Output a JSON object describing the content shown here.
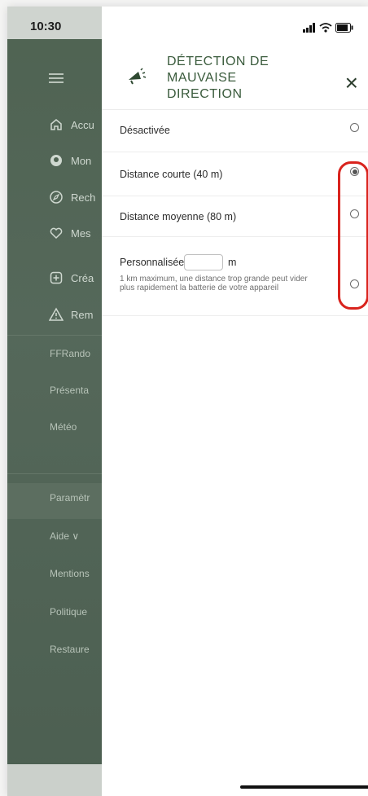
{
  "status_bar": {
    "time": "10:30"
  },
  "sidebar": {
    "menu_icon": "hamburger-icon",
    "items": [
      {
        "label": "Accu",
        "icon": "home-icon"
      },
      {
        "label": "Mon",
        "icon": "profile-icon"
      },
      {
        "label": "Rech",
        "icon": "compass-icon"
      },
      {
        "label": "Mes",
        "icon": "heart-icon"
      },
      {
        "label": "Créa",
        "icon": "plus-square-icon"
      },
      {
        "label": "Rem",
        "icon": "warning-icon"
      }
    ],
    "links": [
      {
        "label": "FFRando"
      },
      {
        "label": "Présenta"
      },
      {
        "label": "Météo"
      },
      {
        "label": "Paramètr"
      },
      {
        "label": "Aide ∨"
      },
      {
        "label": "Mentions"
      },
      {
        "label": "Politique"
      },
      {
        "label": "Restaure"
      }
    ]
  },
  "panel": {
    "title": "DÉTECTION DE MAUVAISE DIRECTION",
    "close_label": "×",
    "options": [
      {
        "label": "Désactivée",
        "checked": false
      },
      {
        "label": "Distance courte (40 m)",
        "checked": true
      },
      {
        "label": "Distance moyenne (80 m)",
        "checked": false
      },
      {
        "label": "Personnalisée:",
        "unit": "m",
        "input_value": "",
        "hint": "1 km maximum, une distance trop grande peut vider plus rapidement la batterie de votre appareil",
        "checked": false
      }
    ]
  },
  "colors": {
    "sidebar_bg": "#4f6352",
    "title_green": "#3a5b3c",
    "highlight_red": "#d9231d"
  }
}
